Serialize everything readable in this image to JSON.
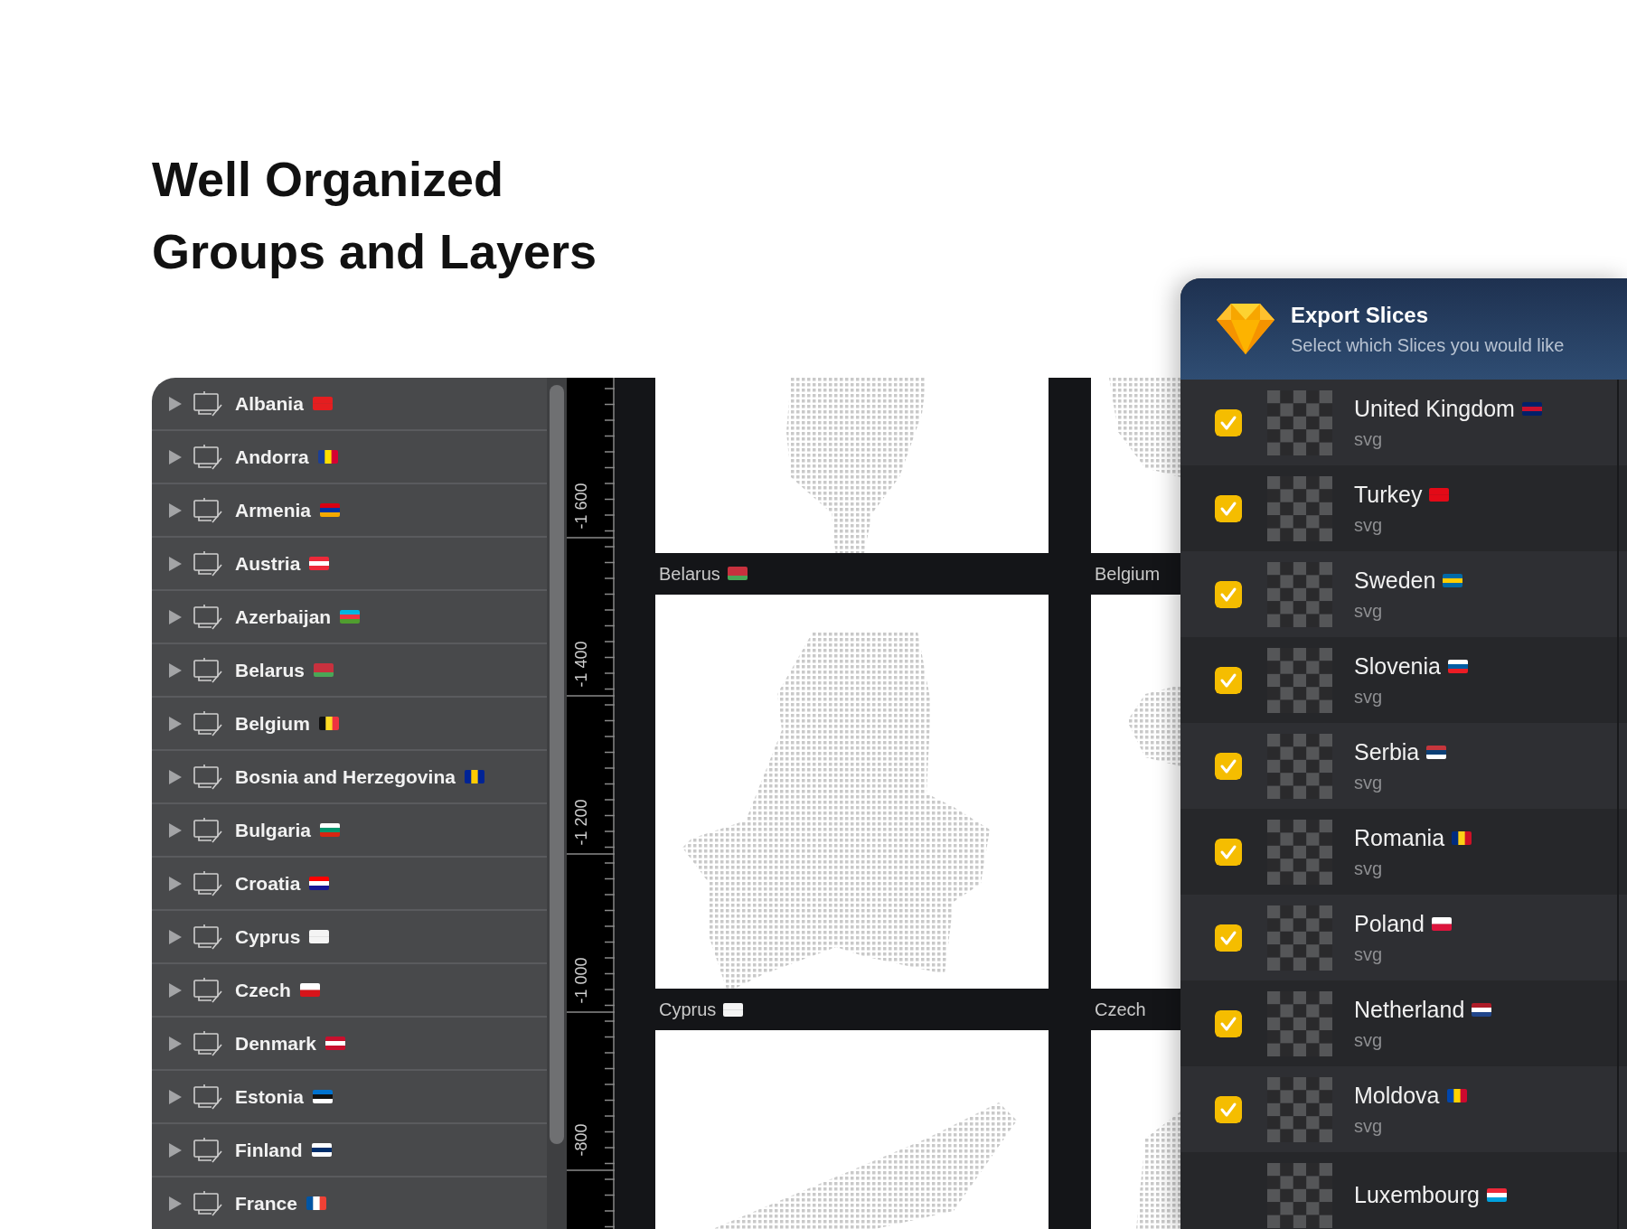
{
  "headline": [
    "Well Organized",
    "Groups and Layers"
  ],
  "layers": [
    {
      "name": "Albania",
      "expanded": false
    },
    {
      "name": "Andorra",
      "expanded": false
    },
    {
      "name": "Armenia",
      "expanded": false
    },
    {
      "name": "Austria",
      "expanded": false
    },
    {
      "name": "Azerbaijan",
      "expanded": false
    },
    {
      "name": "Belarus",
      "expanded": false
    },
    {
      "name": "Belgium",
      "expanded": false
    },
    {
      "name": "Bosnia and Herzegovina",
      "expanded": false
    },
    {
      "name": "Bulgaria",
      "expanded": false
    },
    {
      "name": "Croatia",
      "expanded": false
    },
    {
      "name": "Cyprus",
      "expanded": false
    },
    {
      "name": "Czech",
      "expanded": false
    },
    {
      "name": "Denmark",
      "expanded": false
    },
    {
      "name": "Estonia",
      "expanded": false
    },
    {
      "name": "Finland",
      "expanded": false
    },
    {
      "name": "France",
      "expanded": false
    }
  ],
  "ruler": {
    "labels": [
      "-1 600",
      "-1 400",
      "-1 200",
      "-1 000",
      "-800"
    ]
  },
  "artboards": [
    {
      "label": "Belarus"
    },
    {
      "label": "Belgium"
    },
    {
      "label": "Cyprus"
    },
    {
      "label": "Czech"
    }
  ],
  "export_dialog": {
    "title": "Export Slices",
    "subtitle": "Select which Slices you would like",
    "slices": [
      {
        "name": "United Kingdom",
        "format": "svg",
        "checked": true
      },
      {
        "name": "Turkey",
        "format": "svg",
        "checked": true
      },
      {
        "name": "Sweden",
        "format": "svg",
        "checked": true
      },
      {
        "name": "Slovenia",
        "format": "svg",
        "checked": true
      },
      {
        "name": "Serbia",
        "format": "svg",
        "checked": true
      },
      {
        "name": "Romania",
        "format": "svg",
        "checked": true
      },
      {
        "name": "Poland",
        "format": "svg",
        "checked": true
      },
      {
        "name": "Netherland",
        "format": "svg",
        "checked": true
      },
      {
        "name": "Moldova",
        "format": "svg",
        "checked": true
      },
      {
        "name": "Luxembourg"
      }
    ]
  }
}
